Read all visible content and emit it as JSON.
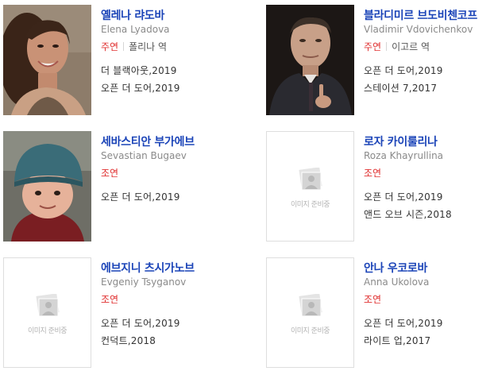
{
  "placeholder_text": "이미지 준비중",
  "colors": {
    "name": "#1b44b8",
    "role": "#e03030",
    "english_name": "#8a8a8a",
    "text": "#333333"
  },
  "cast": [
    {
      "name_ko": "옐레나 랴도바",
      "name_en": "Elena Lyadova",
      "role": "주연",
      "character": "폴리나 역",
      "photo": "actress-portrait",
      "works": [
        "더 블랙아웃,2019",
        "오픈 더 도어,2019"
      ]
    },
    {
      "name_ko": "블라디미르 브도비첸코프",
      "name_en": "Vladimir Vdovichenkov",
      "role": "주연",
      "character": "이고르 역",
      "photo": "actor-portrait",
      "works": [
        "오픈 더 도어,2019",
        "스테이션 7,2017"
      ]
    },
    {
      "name_ko": "세바스티안 부가에브",
      "name_en": "Sevastian Bugaev",
      "role": "조연",
      "character": "",
      "photo": "child-actor-portrait",
      "works": [
        "오픈 더 도어,2019"
      ]
    },
    {
      "name_ko": "로자 카이룰리나",
      "name_en": "Roza Khayrullina",
      "role": "조연",
      "character": "",
      "photo": "placeholder",
      "works": [
        "오픈 더 도어,2019",
        "앤드 오브 시즌,2018"
      ]
    },
    {
      "name_ko": "에브지니 츠시가노브",
      "name_en": "Evgeniy Tsyganov",
      "role": "조연",
      "character": "",
      "photo": "placeholder",
      "works": [
        "오픈 더 도어,2019",
        "컨덕트,2018"
      ]
    },
    {
      "name_ko": "안나 우코로바",
      "name_en": "Anna Ukolova",
      "role": "조연",
      "character": "",
      "photo": "placeholder",
      "works": [
        "오픈 더 도어,2019",
        "라이트 업,2017"
      ]
    }
  ]
}
